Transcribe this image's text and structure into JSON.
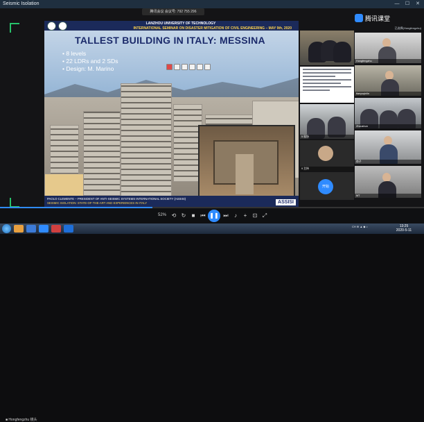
{
  "window": {
    "title": "Seismic Isolation"
  },
  "meeting_bar": {
    "text": "腾讯会议 会议号: 792 755 296"
  },
  "brand": {
    "name": "腾讯课堂",
    "color": "#2f8bff"
  },
  "slide": {
    "university": "LANZHOU UNIVERSITY OF TECHNOLOGY",
    "seminar": "INTERNATIONAL SEMINAR ON DISASTER MITIGATION OF CIVIL ENGINEERING  –  MAY 9th, 2020",
    "title": "TALLEST BUILDING IN ITALY: MESSINA",
    "bullets": [
      "8 levels",
      "22 LDRs and 2 SDs",
      "Design: M. Marino"
    ],
    "footer_line1": "PAOLO CLEMENTE – PRESIDENT OF ANTI-SEISMIC SYSTEMS INTERNATIONAL SOCIETY (ASSISI)",
    "footer_line2": "SEISMIC ISOLATION: STATE-OF-THE-ART AND EXPERIENCES IN ITALY",
    "logo": "ASSISI"
  },
  "middle_panel": {
    "tiles": [
      {
        "caption": "",
        "kind": "group-photo"
      },
      {
        "caption": "",
        "kind": "document"
      },
      {
        "caption": "5 现场",
        "kind": "room"
      },
      {
        "caption": "9 主持",
        "kind": "avatar"
      },
      {
        "caption": "",
        "kind": "blue-avatar",
        "label": "开始"
      }
    ]
  },
  "right_panel": {
    "header": "已选择(Hongfengzhu)",
    "tiles": [
      {
        "caption": "Hongfengzhu"
      },
      {
        "caption": "tianyuqinlin"
      },
      {
        "caption": "Zhoushun"
      },
      {
        "caption": "徐子"
      },
      {
        "caption": "MT"
      }
    ]
  },
  "playback": {
    "zoom": "52%",
    "status_text": "■ Hongfengzhu 镜头"
  },
  "progress_fraction": 0.36,
  "taskbar": {
    "tray": "CH  ⊕  ▲  ◆  ♪",
    "time": "13:25",
    "date": "2020-5-11"
  }
}
